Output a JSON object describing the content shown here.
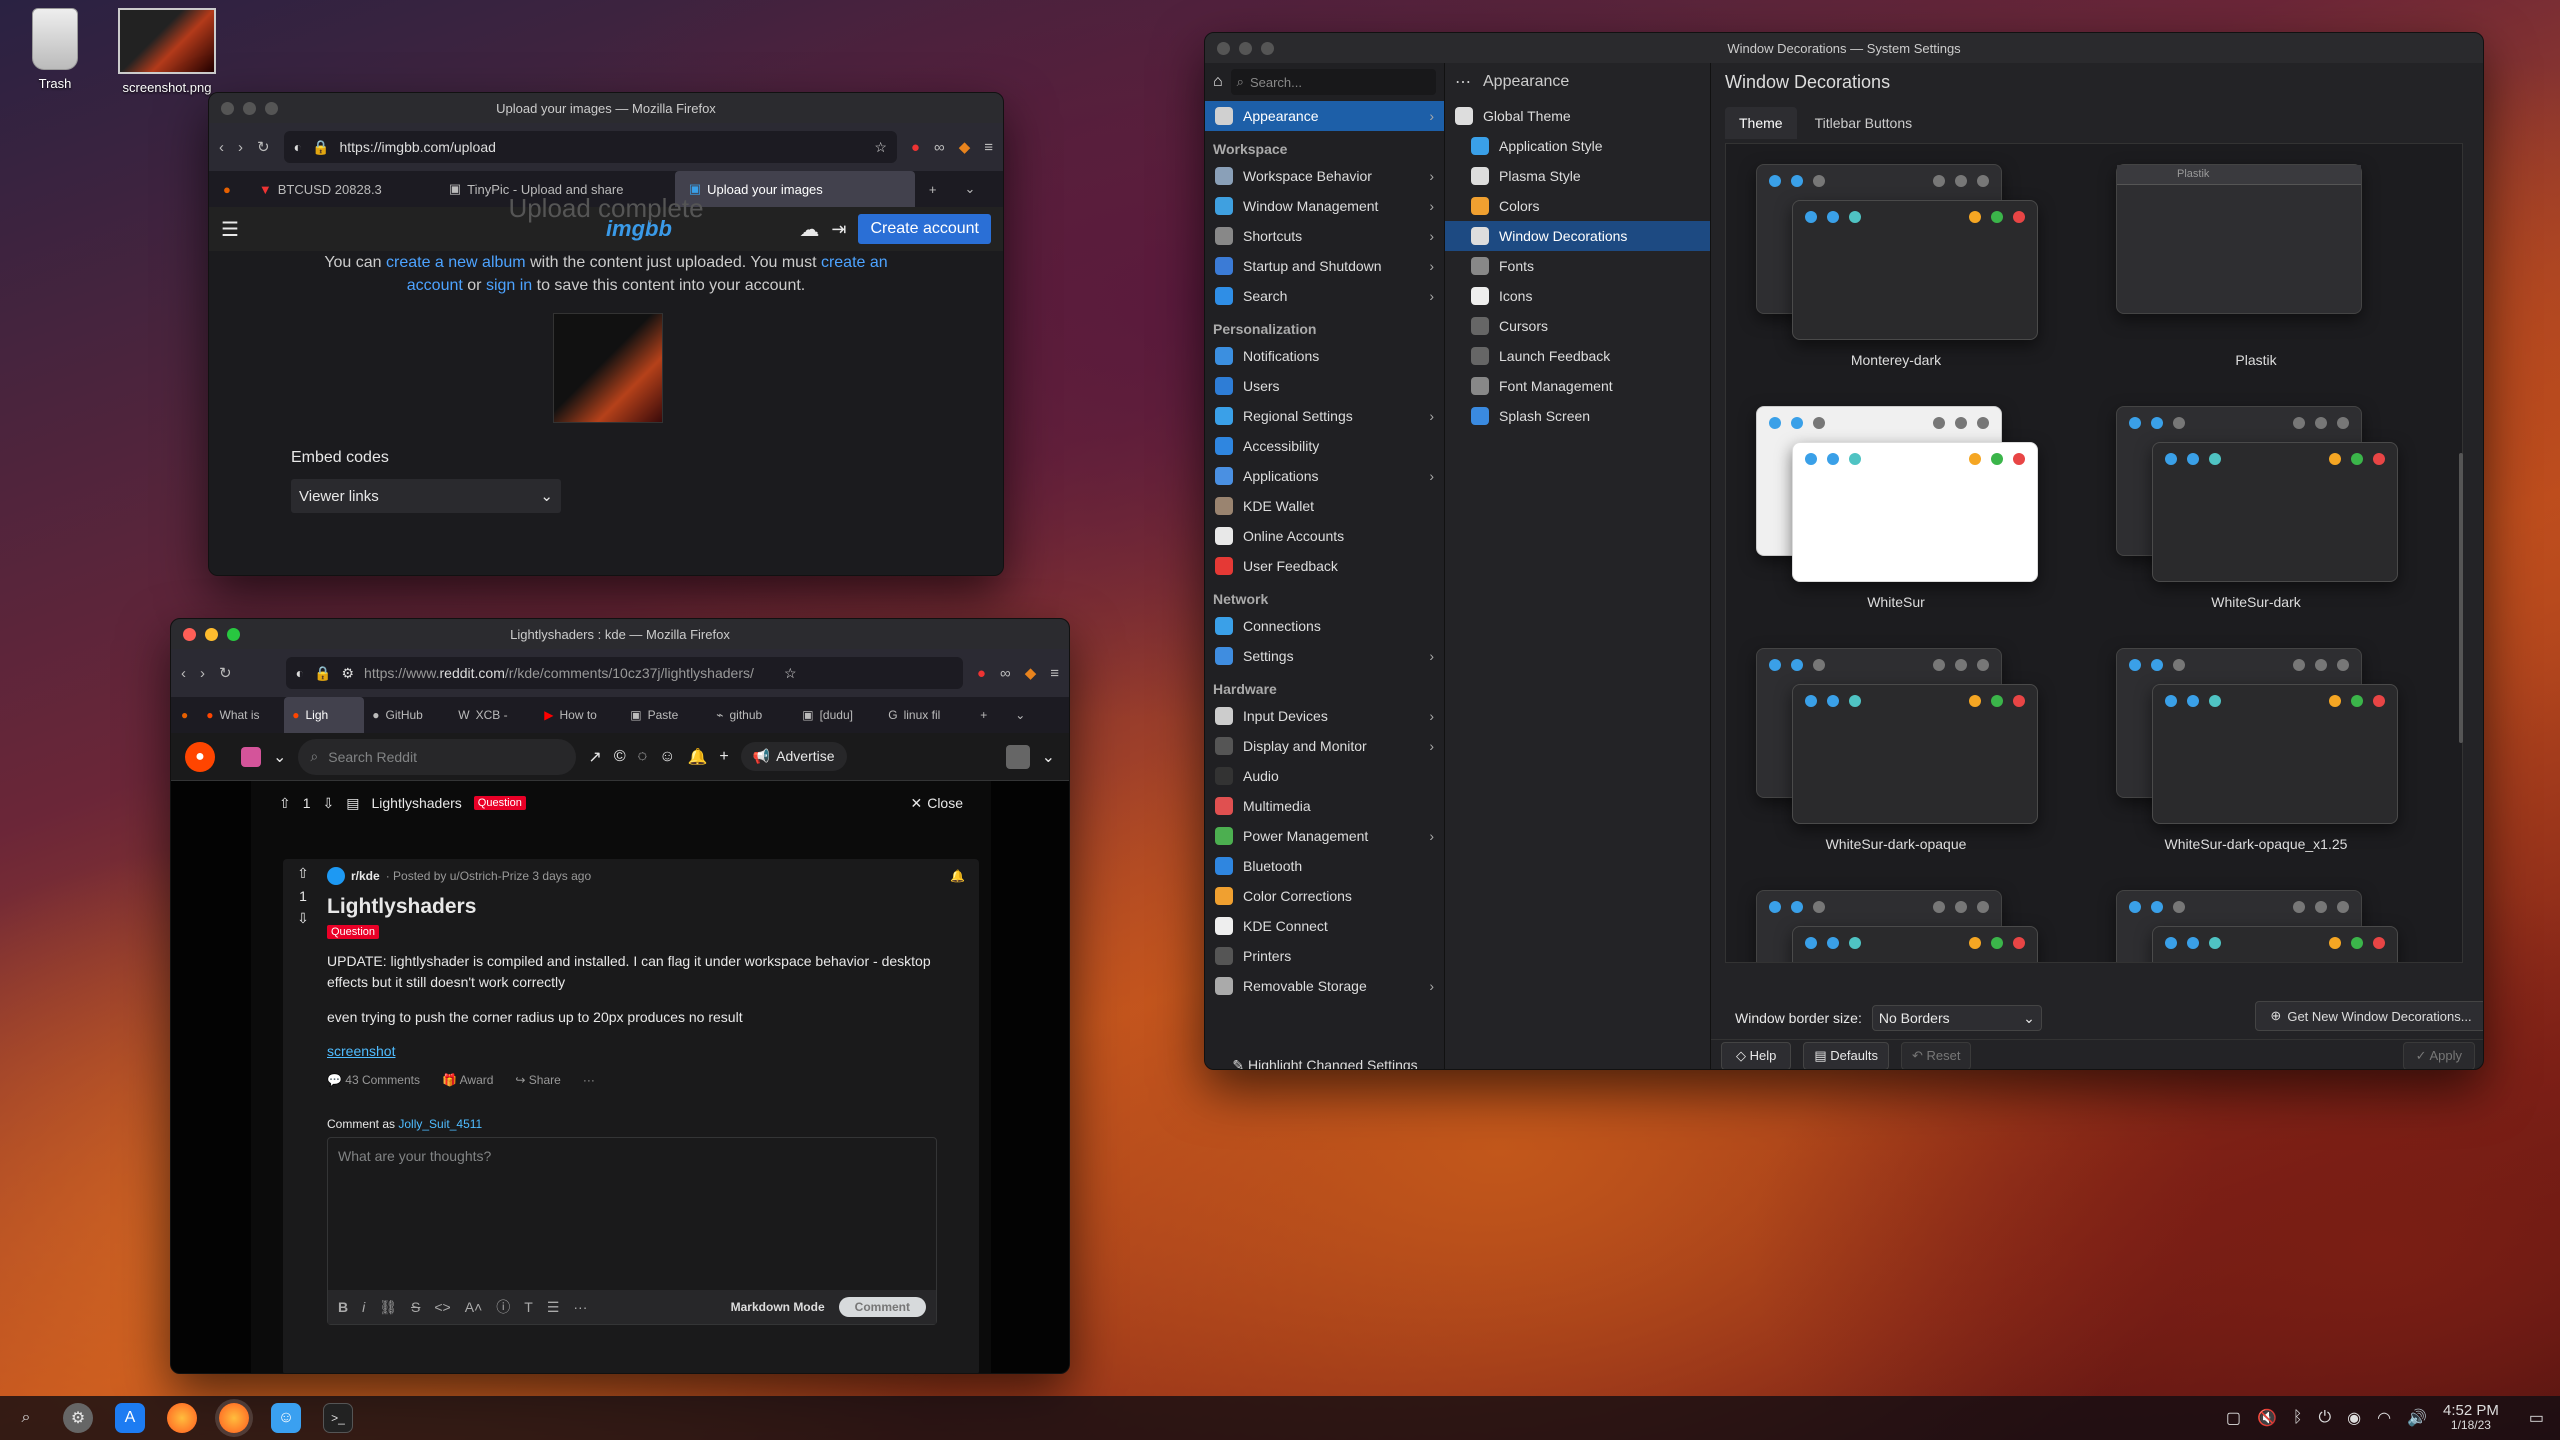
{
  "desktop": {
    "icons": [
      {
        "label": "Trash"
      },
      {
        "label": "screenshot.png"
      }
    ]
  },
  "imgbb": {
    "title": "Upload your images — Mozilla Firefox",
    "url": "https://imgbb.com/upload",
    "tabs": [
      "BTCUSD 20828.3",
      "TinyPic - Upload and share",
      "Upload your images"
    ],
    "logo": "imgbb",
    "create_account": "Create account",
    "heading": "Upload complete",
    "body_line1a": "You can ",
    "link_album": "create a new album",
    "body_line1b": " with the content just uploaded. You must ",
    "link_create": "create an",
    "link_account": "account",
    "body_or": " or ",
    "link_signin": "sign in",
    "body_line2b": " to save this content into your account.",
    "embed_label": "Embed codes",
    "embed_select": "Viewer links"
  },
  "reddit": {
    "title": "Lightlyshaders : kde — Mozilla Firefox",
    "url_prefix": "https://www.",
    "url_host": "reddit.com",
    "url_path": "/r/kde/comments/10cz37j/lightlyshaders/",
    "tabs": [
      "What is",
      "Ligh",
      "GitHub",
      "XCB -",
      "How to",
      "Paste",
      "github",
      "[dudu]",
      "linux fil"
    ],
    "search_placeholder": "Search Reddit",
    "advertise": "Advertise",
    "vote_count": "1",
    "post_title_bar": "Lightlyshaders",
    "flair": "Question",
    "close": "Close",
    "subreddit": "r/kde",
    "posted_by": "· Posted by u/Ostrich-Prize 3 days ago",
    "post_title": "Lightlyshaders",
    "body1": "UPDATE: lightlyshader is compiled and installed. I can flag it under workspace behavior - desktop effects but it still doesn't work correctly",
    "body2": "even trying to push the corner radius up to 20px produces no result",
    "link": "screenshot",
    "comments": "43 Comments",
    "award": "Award",
    "share": "Share",
    "comment_as": "Comment as",
    "user": "Jolly_Suit_4511",
    "comment_placeholder": "What are your thoughts?",
    "markdown": "Markdown Mode",
    "comment_btn": "Comment"
  },
  "settings": {
    "title": "Window Decorations — System Settings",
    "search_placeholder": "Search...",
    "col2_header": "Appearance",
    "page_title": "Window Decorations",
    "sidebar": [
      {
        "type": "item",
        "label": "Appearance",
        "color": "#d0d0d0",
        "active": true,
        "chev": true
      },
      {
        "type": "section",
        "label": "Workspace"
      },
      {
        "type": "item",
        "label": "Workspace Behavior",
        "color": "#8aa0b8",
        "chev": true
      },
      {
        "type": "item",
        "label": "Window Management",
        "color": "#3fa0e0",
        "chev": true
      },
      {
        "type": "item",
        "label": "Shortcuts",
        "color": "#888",
        "chev": true
      },
      {
        "type": "item",
        "label": "Startup and Shutdown",
        "color": "#3b7bd6",
        "chev": true
      },
      {
        "type": "item",
        "label": "Search",
        "color": "#2f8ee6",
        "chev": true
      },
      {
        "type": "section",
        "label": "Personalization"
      },
      {
        "type": "item",
        "label": "Notifications",
        "color": "#3b8fe0"
      },
      {
        "type": "item",
        "label": "Users",
        "color": "#2e7dd6"
      },
      {
        "type": "item",
        "label": "Regional Settings",
        "color": "#3aa0e8",
        "chev": true
      },
      {
        "type": "item",
        "label": "Accessibility",
        "color": "#2f86e0"
      },
      {
        "type": "item",
        "label": "Applications",
        "color": "#4a90e2",
        "chev": true
      },
      {
        "type": "item",
        "label": "KDE Wallet",
        "color": "#9a8470"
      },
      {
        "type": "item",
        "label": "Online Accounts",
        "color": "#e8e8e8"
      },
      {
        "type": "item",
        "label": "User Feedback",
        "color": "#e53935"
      },
      {
        "type": "section",
        "label": "Network"
      },
      {
        "type": "item",
        "label": "Connections",
        "color": "#3aa0e8"
      },
      {
        "type": "item",
        "label": "Settings",
        "color": "#3f8de0",
        "chev": true
      },
      {
        "type": "section",
        "label": "Hardware"
      },
      {
        "type": "item",
        "label": "Input Devices",
        "color": "#ccc",
        "chev": true
      },
      {
        "type": "item",
        "label": "Display and Monitor",
        "color": "#555",
        "chev": true
      },
      {
        "type": "item",
        "label": "Audio",
        "color": "#333"
      },
      {
        "type": "item",
        "label": "Multimedia",
        "color": "#e05050"
      },
      {
        "type": "item",
        "label": "Power Management",
        "color": "#4caf50",
        "chev": true
      },
      {
        "type": "item",
        "label": "Bluetooth",
        "color": "#2f86e0"
      },
      {
        "type": "item",
        "label": "Color Corrections",
        "color": "#f0a030"
      },
      {
        "type": "item",
        "label": "KDE Connect",
        "color": "#eee"
      },
      {
        "type": "item",
        "label": "Printers",
        "color": "#555"
      },
      {
        "type": "item",
        "label": "Removable Storage",
        "color": "#aaa",
        "chev": true
      }
    ],
    "highlight_changed": "Highlight Changed Settings",
    "appearance_items": [
      {
        "label": "Global Theme",
        "color": "#ddd"
      },
      {
        "label": "Application Style",
        "color": "#3aa0e8"
      },
      {
        "label": "Plasma Style",
        "color": "#ddd"
      },
      {
        "label": "Colors",
        "color": "#f0a030"
      },
      {
        "label": "Window Decorations",
        "color": "#ddd",
        "active": true
      },
      {
        "label": "Fonts",
        "color": "#888"
      },
      {
        "label": "Icons",
        "color": "#eee"
      },
      {
        "label": "Cursors",
        "color": "#666"
      },
      {
        "label": "Launch Feedback",
        "color": "#666"
      },
      {
        "label": "Font Management",
        "color": "#888"
      },
      {
        "label": "Splash Screen",
        "color": "#3a8ae0"
      }
    ],
    "tabs": [
      {
        "label": "Theme",
        "active": true
      },
      {
        "label": "Titlebar Buttons"
      }
    ],
    "decorations": [
      {
        "name": "Monterey-dark",
        "style": "dark"
      },
      {
        "name": "Plastik",
        "style": "plastik"
      },
      {
        "name": "WhiteSur",
        "style": "light"
      },
      {
        "name": "WhiteSur-dark",
        "style": "dark2"
      },
      {
        "name": "WhiteSur-dark-opaque",
        "style": "dark"
      },
      {
        "name": "WhiteSur-dark-opaque_x1.25",
        "style": "dark2"
      }
    ],
    "plastik_title": "Plastik",
    "border_label": "Window border size:",
    "border_value": "No Borders",
    "get_new": "Get New Window Decorations...",
    "help": "Help",
    "defaults": "Defaults",
    "reset": "Reset",
    "apply": "Apply"
  },
  "taskbar": {
    "time": "4:52 PM",
    "date": "1/18/23"
  }
}
